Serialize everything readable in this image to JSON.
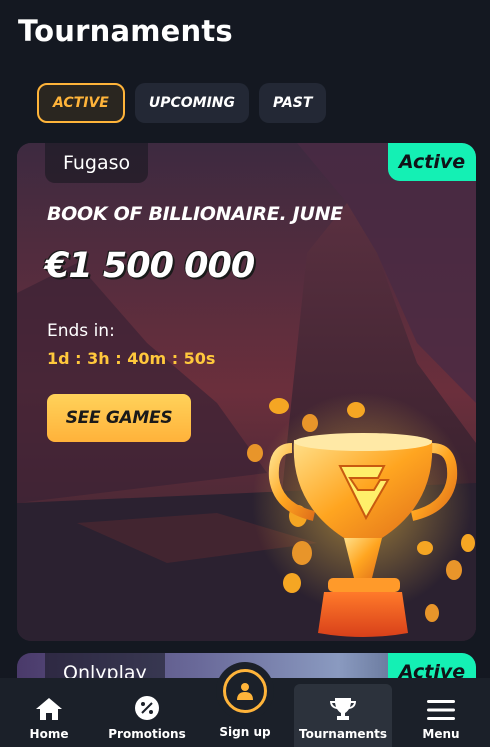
{
  "page": {
    "title": "Tournaments"
  },
  "filters": [
    {
      "label": "ACTIVE",
      "selected": true
    },
    {
      "label": "UPCOMING",
      "selected": false
    },
    {
      "label": "PAST",
      "selected": false
    }
  ],
  "tournaments": [
    {
      "provider": "Fugaso",
      "status": "Active",
      "name": "BOOK OF BILLIONAIRE. JUNE",
      "prize": "€1 500 000",
      "ends_label": "Ends in:",
      "countdown": "1d : 3h : 40m : 50s",
      "cta": "SEE GAMES"
    },
    {
      "provider": "Onlyplay",
      "status": "Active"
    }
  ],
  "nav": [
    {
      "label": "Home",
      "icon": "home-icon"
    },
    {
      "label": "Promotions",
      "icon": "percent-icon"
    },
    {
      "label": "Sign up",
      "icon": "user-icon"
    },
    {
      "label": "Tournaments",
      "icon": "trophy-icon",
      "current": true
    },
    {
      "label": "Menu",
      "icon": "hamburger-icon"
    }
  ],
  "colors": {
    "background": "#141821",
    "accent": "#ffb43a",
    "active_badge": "#14f0b4",
    "countdown": "#ffc83c"
  }
}
